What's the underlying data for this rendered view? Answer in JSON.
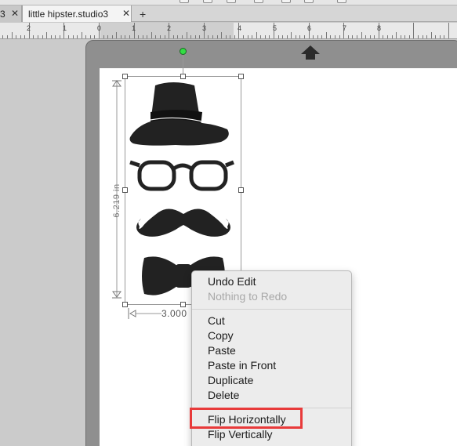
{
  "tabs": [
    {
      "label": "3",
      "close": "✕"
    },
    {
      "label": "little hipster.studio3",
      "close": "✕"
    }
  ],
  "add_tab": "+",
  "ruler": {
    "labels": [
      "2",
      "1",
      "0",
      "1",
      "2",
      "3",
      "4",
      "5",
      "6",
      "7",
      "8"
    ]
  },
  "dimensions": {
    "height": "6.219 in",
    "width": "3.000"
  },
  "context_menu": {
    "undo": "Undo Edit",
    "redo": "Nothing to Redo",
    "cut": "Cut",
    "copy": "Copy",
    "paste": "Paste",
    "paste_in_front": "Paste in Front",
    "duplicate": "Duplicate",
    "delete": "Delete",
    "flip_h": "Flip Horizontally",
    "flip_v": "Flip Vertically"
  },
  "colors": {
    "highlight": "#e83a3a",
    "rotate_handle": "#33dd44",
    "shape": "#222222"
  }
}
